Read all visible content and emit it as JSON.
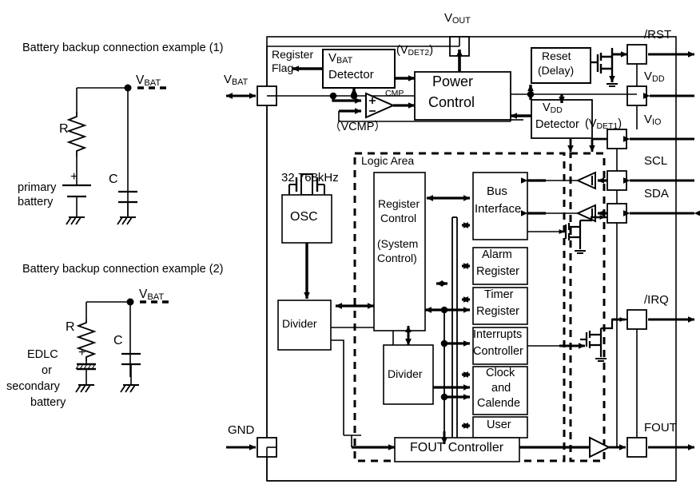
{
  "figure": {
    "type": "block-diagram",
    "subject": "Real-time clock IC internal block diagram with battery backup connection examples"
  },
  "left_examples": [
    {
      "id": "example1",
      "title": "Battery backup connection example (1)",
      "node_label": "VBAT",
      "node_label_main": "V",
      "node_label_sub": "BAT",
      "resistor_label": "R",
      "capacitor_label": "C",
      "polarity_label": "+",
      "source_lines": [
        "primary",
        "battery"
      ]
    },
    {
      "id": "example2",
      "title": "Battery backup connection example (2)",
      "node_label": "VBAT",
      "node_label_main": "V",
      "node_label_sub": "BAT",
      "resistor_label": "R",
      "capacitor_label": "C",
      "polarity_label": "+",
      "source_lines": [
        "EDLC",
        "or",
        "secondary",
        "battery"
      ]
    }
  ],
  "chip": {
    "pins": [
      {
        "name": "VBAT",
        "main": "V",
        "sub": "BAT",
        "side": "left",
        "direction": "bidirectional"
      },
      {
        "name": "GND",
        "main": "GND",
        "sub": "",
        "side": "left",
        "direction": "in"
      },
      {
        "name": "VOUT",
        "main": "V",
        "sub": "OUT",
        "side": "top",
        "direction": "out"
      },
      {
        "name": "/RST",
        "main": "/RST",
        "sub": "",
        "side": "right",
        "direction": "out"
      },
      {
        "name": "VDD",
        "main": "V",
        "sub": "DD",
        "side": "right",
        "direction": "in"
      },
      {
        "name": "VIO",
        "main": "V",
        "sub": "IO",
        "side": "right",
        "direction": "in"
      },
      {
        "name": "SCL",
        "main": "SCL",
        "sub": "",
        "side": "right",
        "direction": "in"
      },
      {
        "name": "SDA",
        "main": "SDA",
        "sub": "",
        "side": "right",
        "direction": "bidirectional"
      },
      {
        "name": "/IRQ",
        "main": "/IRQ",
        "sub": "",
        "side": "right",
        "direction": "out"
      },
      {
        "name": "FOUT",
        "main": "FOUT",
        "sub": "",
        "side": "right",
        "direction": "out"
      }
    ],
    "blocks": [
      {
        "id": "vbat-detector",
        "lines": [
          "VBAT",
          "Detector"
        ],
        "line1_main": "V",
        "line1_sub": "BAT",
        "line2": "Detector"
      },
      {
        "id": "power-control",
        "lines": [
          "Power",
          "Control"
        ]
      },
      {
        "id": "reset-delay",
        "lines": [
          "Reset",
          "(Delay)"
        ]
      },
      {
        "id": "vdd-detector",
        "lines": [
          "VDD",
          "Detector"
        ],
        "line1_main": "V",
        "line1_sub": "DD",
        "line2": "Detector"
      },
      {
        "id": "osc",
        "lines": [
          "OSC"
        ]
      },
      {
        "id": "divider-1",
        "lines": [
          "Divider"
        ]
      },
      {
        "id": "divider-2",
        "lines": [
          "Divider"
        ]
      },
      {
        "id": "register-control",
        "lines": [
          "Register",
          "Control",
          "(System",
          "Control)"
        ]
      },
      {
        "id": "bus-interface",
        "lines": [
          "Bus",
          "Interface"
        ]
      },
      {
        "id": "alarm-register",
        "lines": [
          "Alarm",
          "Register"
        ]
      },
      {
        "id": "timer-register",
        "lines": [
          "Timer",
          "Register"
        ]
      },
      {
        "id": "interrupts-controller",
        "lines": [
          "Interrupts",
          "Controller"
        ]
      },
      {
        "id": "clock-and-calende",
        "lines": [
          "Clock",
          "and",
          "Calende"
        ]
      },
      {
        "id": "user-register",
        "lines": [
          "User"
        ]
      },
      {
        "id": "fout-controller",
        "lines": [
          "FOUT Controller"
        ]
      }
    ],
    "annotations": [
      {
        "id": "register-flag",
        "lines": [
          "Register",
          "Flag"
        ]
      },
      {
        "id": "vdet2",
        "text": "(VDET2)",
        "main_prefix": "(V",
        "sub": "DET2",
        "suffix": ")"
      },
      {
        "id": "vdet1",
        "text": "(VDET1)",
        "main_prefix": "(V",
        "sub": "DET1",
        "suffix": ")"
      },
      {
        "id": "vcmp",
        "text": "（VCMP）"
      },
      {
        "id": "cmp",
        "text": "CMP"
      },
      {
        "id": "crystal-freq",
        "text": "32.768kHz"
      },
      {
        "id": "logic-area",
        "text": "Logic Area"
      }
    ]
  },
  "colors": {
    "line": "#000000",
    "text": "#000000",
    "background": "#ffffff"
  }
}
